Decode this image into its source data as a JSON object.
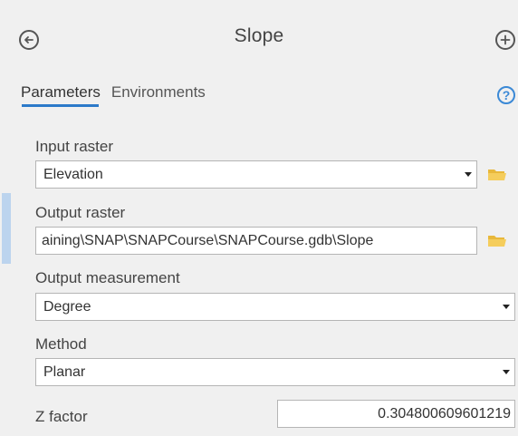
{
  "header": {
    "title": "Slope"
  },
  "tabs": [
    {
      "label": "Parameters"
    },
    {
      "label": "Environments"
    }
  ],
  "help": {
    "glyph": "?"
  },
  "fields": {
    "input_raster": {
      "label": "Input raster",
      "value": "Elevation"
    },
    "output_raster": {
      "label": "Output raster",
      "value": "aining\\SNAP\\SNAPCourse\\SNAPCourse.gdb\\Slope"
    },
    "output_measurement": {
      "label": "Output measurement",
      "value": "Degree"
    },
    "method": {
      "label": "Method",
      "value": "Planar"
    },
    "z_factor": {
      "label": "Z factor",
      "value": "0.304800609601219"
    }
  },
  "icons": {
    "back": "back-arrow-icon",
    "add": "plus-icon",
    "help": "help-icon",
    "browse": "folder-icon",
    "dropdown": "chevron-down-icon"
  },
  "colors": {
    "accent": "#2c7ac9",
    "help": "#3b89d6",
    "folder": "#f0c24f",
    "panel_background": "#f0f0f0"
  }
}
